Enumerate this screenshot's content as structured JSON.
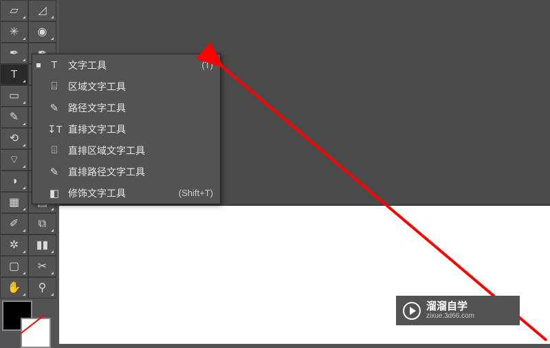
{
  "tools_left": [
    {
      "name": "selection-tool",
      "icon": "▱"
    },
    {
      "name": "magic-wand-tool",
      "icon": "✳"
    },
    {
      "name": "pen-tool",
      "icon": "✒"
    },
    {
      "name": "type-tool",
      "icon": "T",
      "active": true
    },
    {
      "name": "rectangle-tool",
      "icon": "▭"
    },
    {
      "name": "brush-tool",
      "icon": "✎"
    },
    {
      "name": "rotate-tool",
      "icon": "⟲"
    },
    {
      "name": "width-tool",
      "icon": "⌔"
    },
    {
      "name": "shape-builder-tool",
      "icon": "◑"
    },
    {
      "name": "mesh-tool",
      "icon": "▦"
    },
    {
      "name": "eyedropper-tool",
      "icon": "✐"
    },
    {
      "name": "symbol-sprayer-tool",
      "icon": "✲"
    },
    {
      "name": "artboard-tool",
      "icon": "▢"
    },
    {
      "name": "hand-tool",
      "icon": "✋"
    }
  ],
  "tools_right": [
    {
      "name": "direct-selection-tool",
      "icon": "◿"
    },
    {
      "name": "lasso-tool",
      "icon": "◉"
    },
    {
      "name": "curvature-tool",
      "icon": "✒"
    },
    {
      "name": "line-segment-tool",
      "icon": "／"
    },
    {
      "name": "ellipse-tool",
      "icon": "◯"
    },
    {
      "name": "eraser-tool",
      "icon": "◧"
    },
    {
      "name": "scale-tool",
      "icon": "⤢"
    },
    {
      "name": "free-transform-tool",
      "icon": "⛶"
    },
    {
      "name": "perspective-grid-tool",
      "icon": "▥"
    },
    {
      "name": "gradient-tool",
      "icon": "▤"
    },
    {
      "name": "blend-tool",
      "icon": "⧉"
    },
    {
      "name": "column-graph-tool",
      "icon": "▮▮"
    },
    {
      "name": "slice-tool",
      "icon": "✂"
    },
    {
      "name": "zoom-tool",
      "icon": "⚲"
    }
  ],
  "flyout": {
    "items": [
      {
        "name": "type-tool",
        "icon": "T",
        "label": "文字工具",
        "shortcut": "(T)",
        "active": true
      },
      {
        "name": "area-type-tool",
        "icon": "⌸",
        "label": "区域文字工具",
        "shortcut": ""
      },
      {
        "name": "type-on-path-tool",
        "icon": "✎",
        "label": "路径文字工具",
        "shortcut": ""
      },
      {
        "name": "vertical-type-tool",
        "icon": "↧T",
        "label": "直排文字工具",
        "shortcut": ""
      },
      {
        "name": "vertical-area-type-tool",
        "icon": "⌹",
        "label": "直排区域文字工具",
        "shortcut": ""
      },
      {
        "name": "vertical-type-on-path-tool",
        "icon": "✎",
        "label": "直排路径文字工具",
        "shortcut": ""
      },
      {
        "name": "touch-type-tool",
        "icon": "◧",
        "label": "修饰文字工具",
        "shortcut": "(Shift+T)"
      }
    ]
  },
  "watermark": {
    "cn": "溜溜自学",
    "url": "zixue.3d66.com"
  },
  "colors": {
    "arrow": "#ff0000"
  }
}
